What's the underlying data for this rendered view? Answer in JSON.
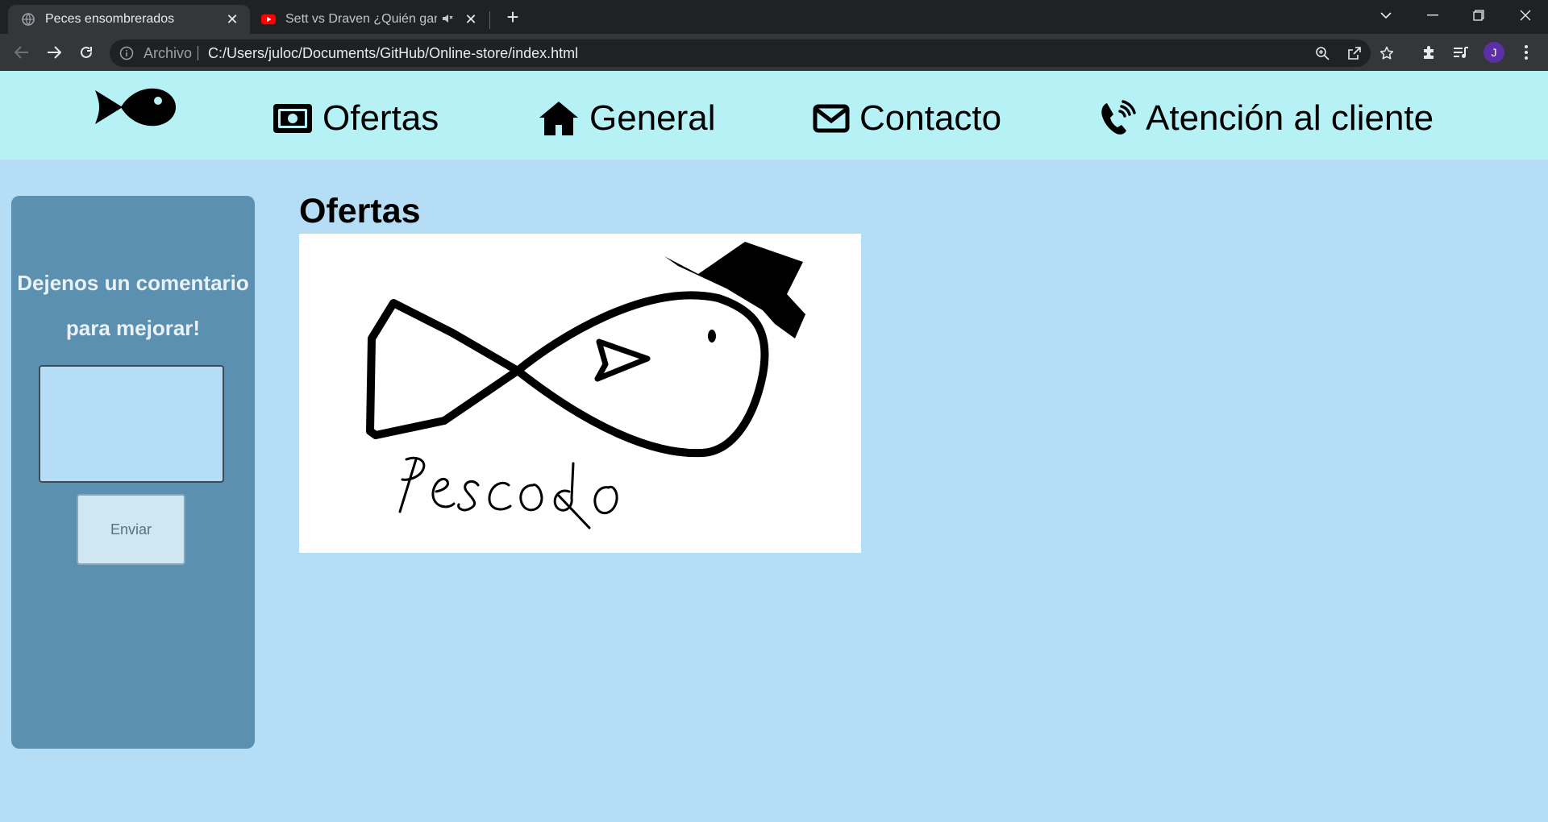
{
  "browser": {
    "tabs": [
      {
        "title": "Peces ensombrerados",
        "active": true,
        "favicon": "globe-icon"
      },
      {
        "title": "Sett vs Draven ¿Quién ganar",
        "active": false,
        "favicon": "youtube-icon",
        "audio": "speaker-icon"
      }
    ],
    "address": {
      "chip": "Archivo",
      "url": "C:/Users/juloc/Documents/GitHub/Online-store/index.html"
    },
    "profile_initial": "J"
  },
  "site": {
    "nav": [
      {
        "label": "Ofertas",
        "icon": "money-bill-icon"
      },
      {
        "label": "General",
        "icon": "home-icon"
      },
      {
        "label": "Contacto",
        "icon": "envelope-icon"
      },
      {
        "label": "Atención al cliente",
        "icon": "phone-volume-icon"
      }
    ],
    "sidebar": {
      "title_line1": "Dejenos un comentario",
      "title_line2": "para mejorar!",
      "comment_value": "",
      "send_label": "Enviar"
    },
    "main": {
      "title": "Ofertas",
      "image_caption": "Pescado"
    }
  },
  "colors": {
    "header_bg": "#b6f1f6",
    "page_bg": "#b5ddf5",
    "sidebar_bg": "#5b90b1"
  }
}
